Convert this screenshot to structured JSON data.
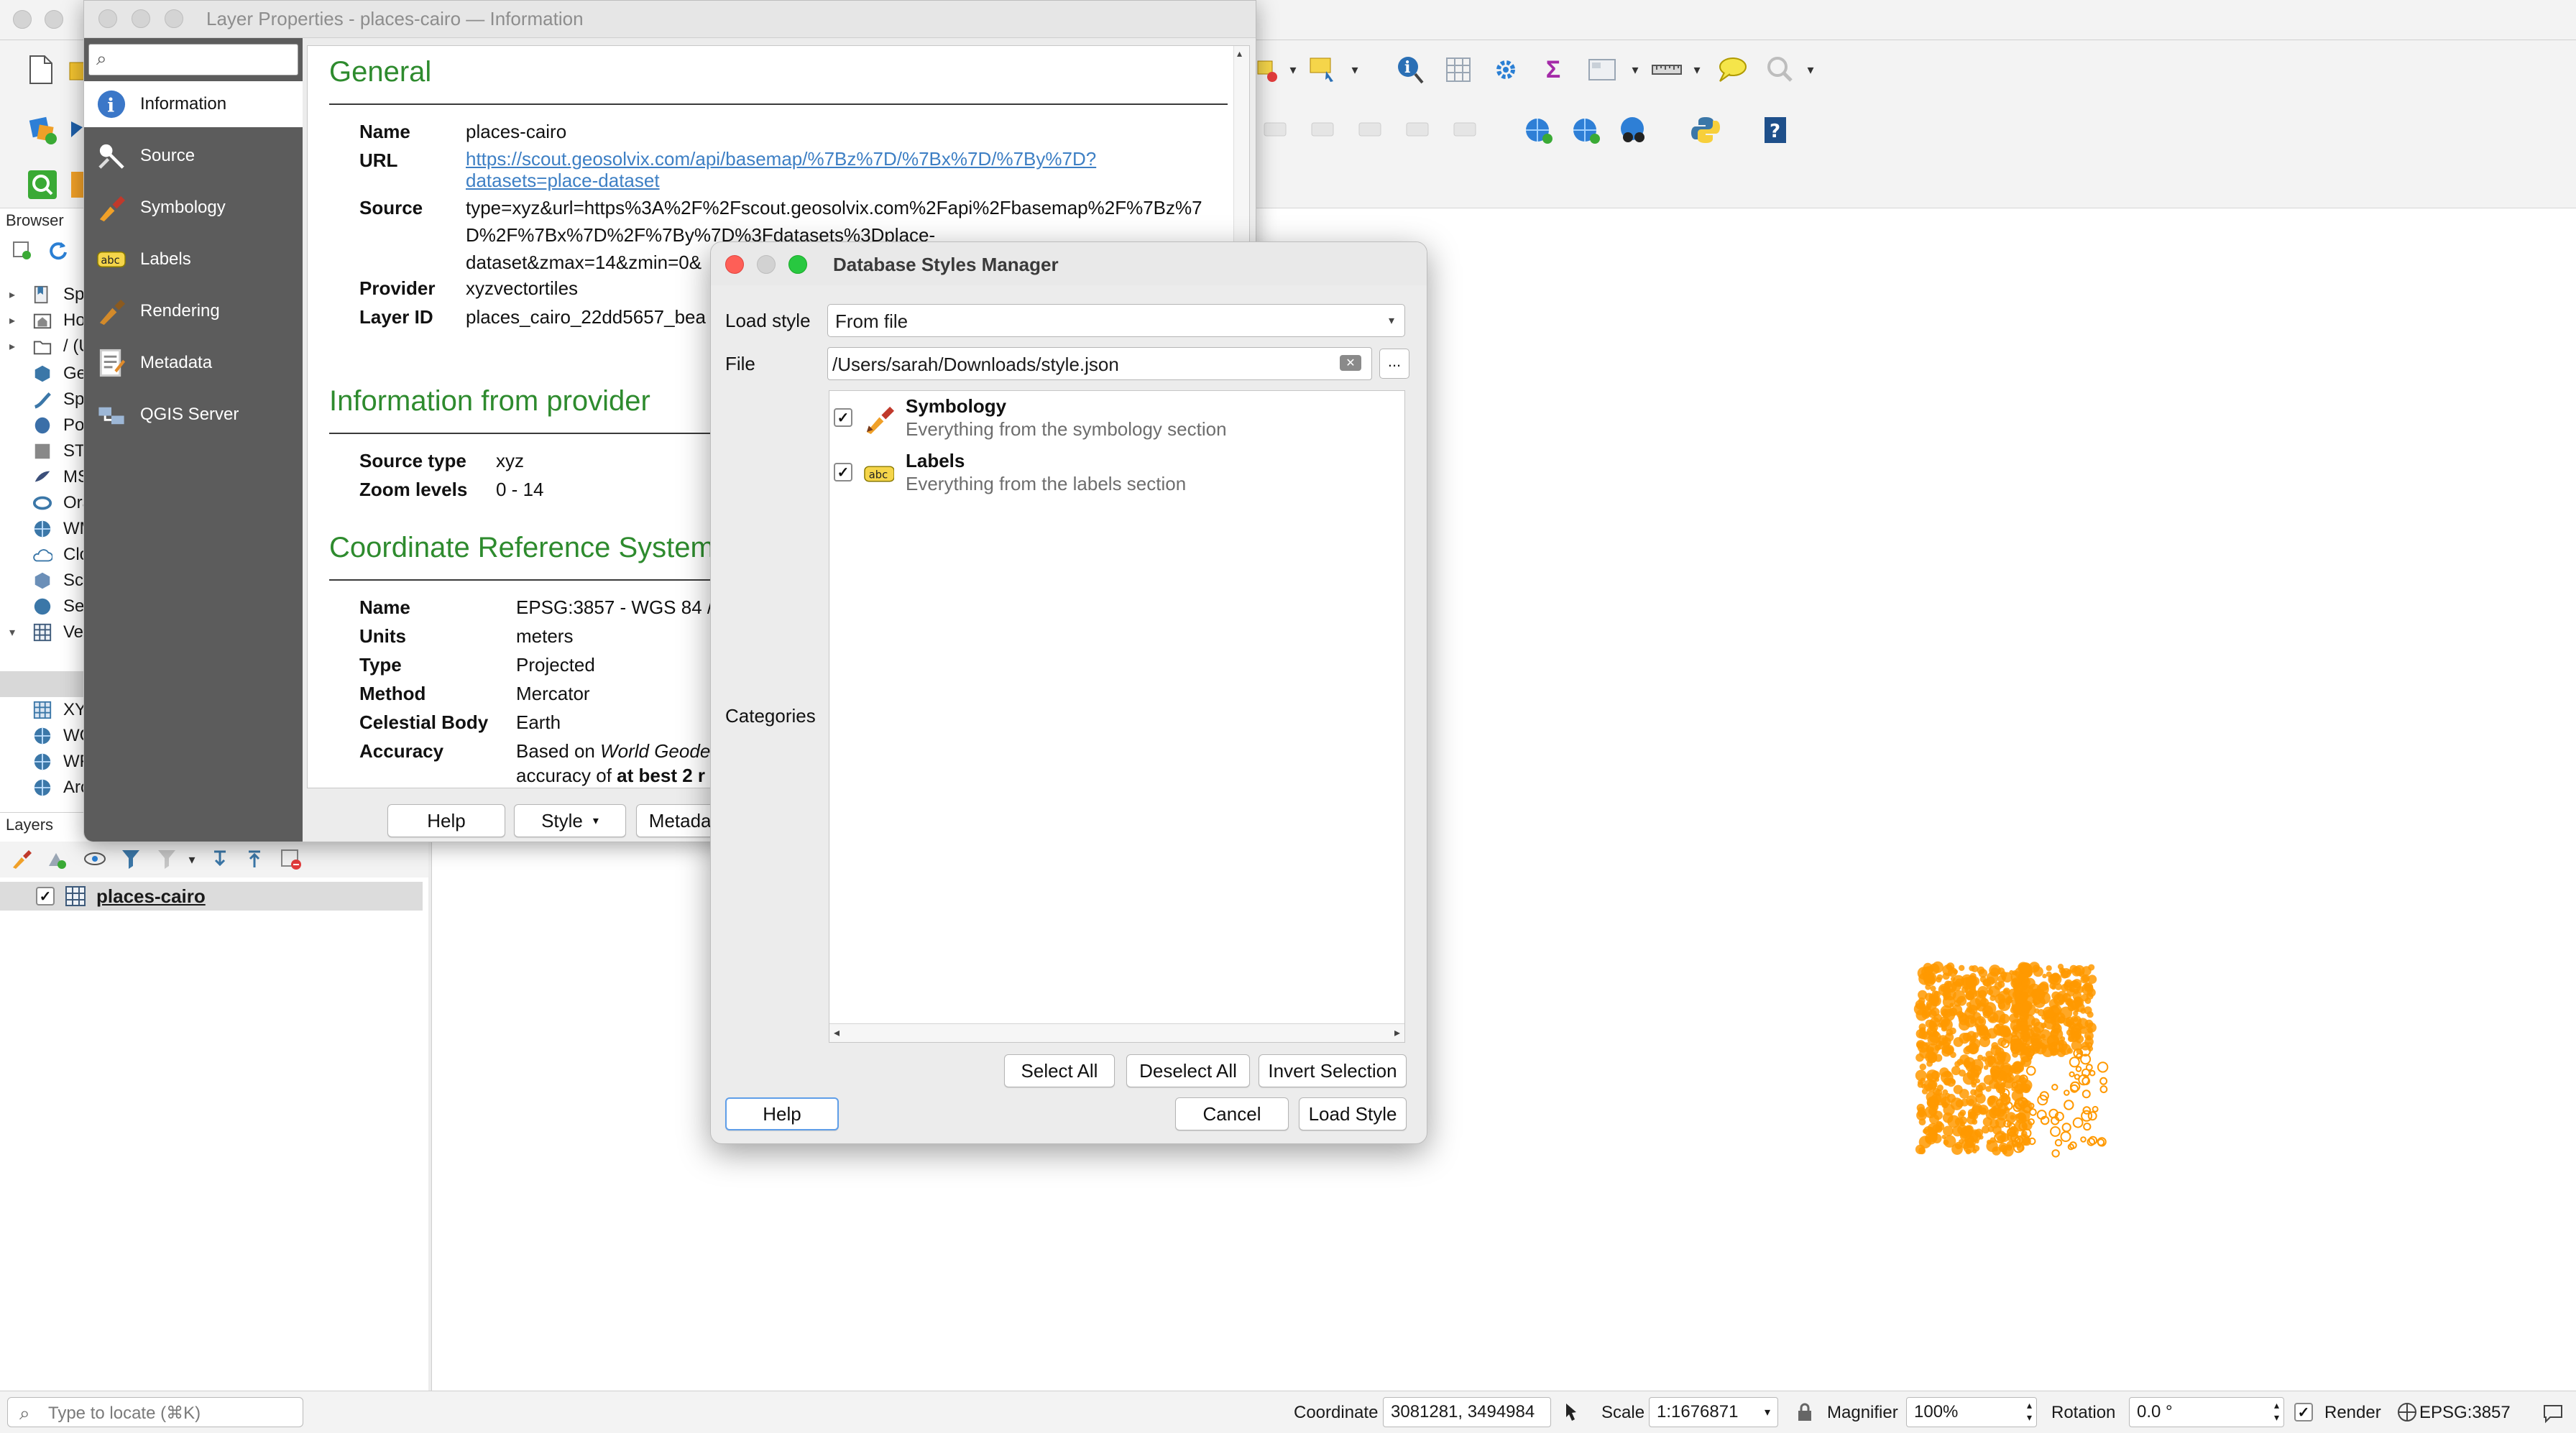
{
  "main": {
    "browser": {
      "title": "Browser",
      "items": [
        {
          "label": "Spa",
          "icon": "spatial-bookmarks-icon",
          "arrow": "▸"
        },
        {
          "label": "Ho",
          "icon": "home-folder-icon",
          "arrow": "▸"
        },
        {
          "label": "/ (U",
          "icon": "root-folder-icon",
          "arrow": "▸"
        },
        {
          "label": "Ge",
          "icon": "geopackage-icon",
          "arrow": ""
        },
        {
          "label": "Spa",
          "icon": "spatialite-icon",
          "arrow": ""
        },
        {
          "label": "Pos",
          "icon": "postgis-icon",
          "arrow": ""
        },
        {
          "label": "STA",
          "icon": "sensorthings-icon",
          "arrow": ""
        },
        {
          "label": "MS",
          "icon": "mssql-icon",
          "arrow": ""
        },
        {
          "label": "Ora",
          "icon": "oracle-icon",
          "arrow": ""
        },
        {
          "label": "WM",
          "icon": "wms-icon",
          "arrow": ""
        },
        {
          "label": "Clo",
          "icon": "cloud-icon",
          "arrow": ""
        },
        {
          "label": "Sce",
          "icon": "scene-icon",
          "arrow": ""
        },
        {
          "label": "Ser",
          "icon": "server-icon",
          "arrow": ""
        },
        {
          "label": "Vec",
          "icon": "vector-tiles-icon",
          "arrow": "▾"
        },
        {
          "label": "",
          "icon": "vector-tile-layer-icon",
          "arrow": ""
        },
        {
          "label": "",
          "icon": "vector-tile-layer-icon",
          "arrow": ""
        },
        {
          "label": "XY",
          "icon": "xyz-tiles-icon",
          "arrow": ""
        },
        {
          "label": "WC",
          "icon": "wcs-icon",
          "arrow": ""
        },
        {
          "label": "WF",
          "icon": "wfs-icon",
          "arrow": ""
        },
        {
          "label": "Arc",
          "icon": "arcgis-icon",
          "arrow": ""
        }
      ]
    },
    "layers": {
      "title": "Layers",
      "layer_name": "places-cairo"
    },
    "status": {
      "locate_placeholder": "Type to locate (⌘K)",
      "coordinate_label": "Coordinate",
      "coordinate_value": "3081281, 3494984",
      "scale_label": "Scale",
      "scale_value": "1:1676871",
      "magnifier_label": "Magnifier",
      "magnifier_value": "100%",
      "rotation_label": "Rotation",
      "rotation_value": "0.0 °",
      "render_label": "Render",
      "crs_label": "EPSG:3857"
    },
    "point_color": "#ff9900"
  },
  "layer_properties": {
    "title": "Layer Properties - places-cairo — Information",
    "nav": [
      {
        "label": "Information",
        "icon": "information-icon"
      },
      {
        "label": "Source",
        "icon": "source-icon"
      },
      {
        "label": "Symbology",
        "icon": "symbology-icon"
      },
      {
        "label": "Labels",
        "icon": "labels-icon"
      },
      {
        "label": "Rendering",
        "icon": "rendering-icon"
      },
      {
        "label": "Metadata",
        "icon": "metadata-icon"
      },
      {
        "label": "QGIS Server",
        "icon": "qgis-server-icon"
      }
    ],
    "general": {
      "heading": "General",
      "name_key": "Name",
      "name_val": "places-cairo",
      "url_key": "URL",
      "url_line1": "https://scout.geosolvix.com/api/basemap/%7Bz%7D/%7Bx%7D/%7By%7D?",
      "url_line2": "datasets=place-dataset",
      "source_key": "Source",
      "source_line1": "type=xyz&url=https%3A%2F%2Fscout.geosolvix.com%2Fapi%2Fbasemap%2F%7Bz%7",
      "source_line2": "D%2F%7Bx%7D%2F%7By%7D%3Fdatasets%3Dplace-",
      "source_line3": "dataset&zmax=14&zmin=0&",
      "provider_key": "Provider",
      "provider_val": "xyzvectortiles",
      "layerid_key": "Layer ID",
      "layerid_val": "places_cairo_22dd5657_bea"
    },
    "provider_info": {
      "heading": "Information from provider",
      "source_type_key": "Source type",
      "source_type_val": "xyz",
      "zoom_key": "Zoom levels",
      "zoom_val": "0 - 14"
    },
    "crs": {
      "heading": "Coordinate Reference System",
      "name_key": "Name",
      "name_val": "EPSG:3857 - WGS 84 /",
      "units_key": "Units",
      "units_val": "meters",
      "type_key": "Type",
      "type_val": "Projected",
      "method_key": "Method",
      "method_val": "Mercator",
      "body_key": "Celestial Body",
      "body_val": "Earth",
      "accuracy_key": "Accuracy",
      "accuracy_line1_a": "Based on ",
      "accuracy_line1_b": "World Geode",
      "accuracy_line2_a": "accuracy of ",
      "accuracy_line2_b": "at best 2 r"
    },
    "footer": {
      "help": "Help",
      "style": "Style",
      "metadata": "Metadata"
    }
  },
  "dialog": {
    "title": "Database Styles Manager",
    "load_style_label": "Load style",
    "load_style_value": "From file",
    "file_label": "File",
    "file_value": "/Users/sarah/Downloads/style.json",
    "browse_label": "...",
    "categories_label": "Categories",
    "categories": [
      {
        "name": "Symbology",
        "desc": "Everything from the symbology section",
        "checked": true,
        "icon": "symbology-brush-icon"
      },
      {
        "name": "Labels",
        "desc": "Everything from the labels section",
        "checked": true,
        "icon": "labels-abc-icon"
      }
    ],
    "select_all": "Select All",
    "deselect_all": "Deselect All",
    "invert_selection": "Invert Selection",
    "help": "Help",
    "cancel": "Cancel",
    "load_style_button": "Load Style"
  }
}
